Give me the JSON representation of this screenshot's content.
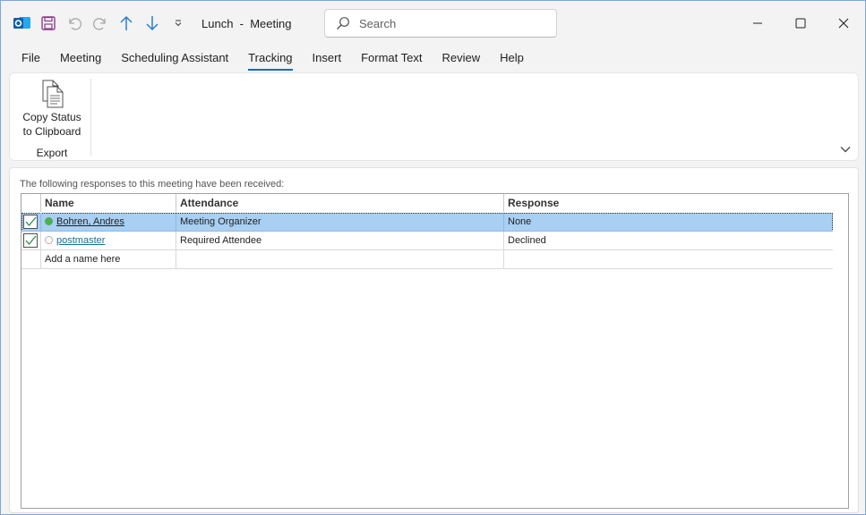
{
  "window": {
    "title": "Lunch  -  Meeting",
    "search_placeholder": "Search"
  },
  "menu": {
    "items": [
      "File",
      "Meeting",
      "Scheduling Assistant",
      "Tracking",
      "Insert",
      "Format Text",
      "Review",
      "Help"
    ],
    "active": "Tracking"
  },
  "ribbon": {
    "copy_status_line1": "Copy Status",
    "copy_status_line2": "to Clipboard",
    "group_label": "Export"
  },
  "tracking": {
    "note": "The following responses to this meeting have been received:",
    "columns": {
      "name": "Name",
      "attendance": "Attendance",
      "response": "Response"
    },
    "rows": [
      {
        "name": "Bohren, Andres",
        "attendance": "Meeting Organizer",
        "response": "None",
        "checked": true,
        "selected": true
      },
      {
        "name": "postmaster",
        "attendance": "Required Attendee",
        "response": "Declined",
        "checked": true,
        "selected": false
      }
    ],
    "add_placeholder": "Add a name here"
  },
  "colors": {
    "accent": "#0f6cbd",
    "selection": "#a9cff2",
    "organizer_status": "#4caf50"
  }
}
